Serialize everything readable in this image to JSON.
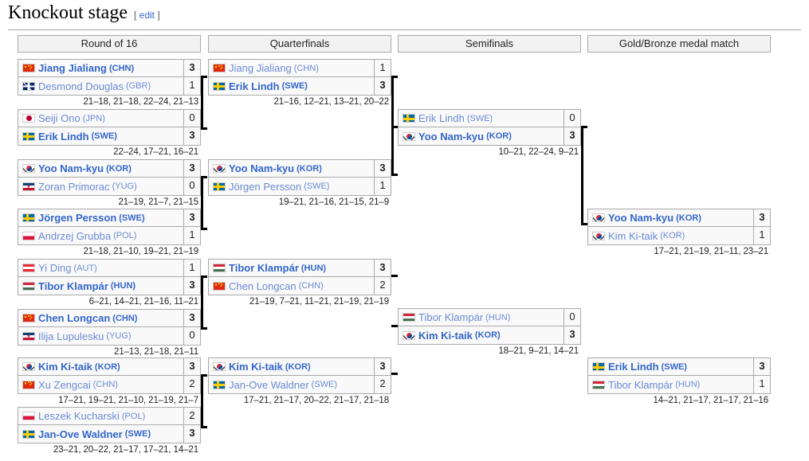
{
  "heading": {
    "title": "Knockout stage",
    "edit_open": "[",
    "edit_label": "edit",
    "edit_close": "]"
  },
  "columns": [
    {
      "label": "Round of 16"
    },
    {
      "label": "Quarterfinals"
    },
    {
      "label": "Semifinals"
    },
    {
      "label": "Gold/Bronze medal match"
    }
  ],
  "matches": {
    "r16_1": {
      "p1": {
        "name": "Jiang Jialiang",
        "code": "(CHN)",
        "flag": "f-chn",
        "score": "3",
        "winner": true
      },
      "p2": {
        "name": "Desmond Douglas",
        "code": "(GBR)",
        "flag": "f-gbr",
        "score": "1",
        "winner": false
      },
      "scores": "21–18, 21–18, 22–24, 21–13"
    },
    "r16_2": {
      "p1": {
        "name": "Seiji Ono",
        "code": "(JPN)",
        "flag": "f-jpn",
        "score": "0",
        "winner": false
      },
      "p2": {
        "name": "Erik Lindh",
        "code": "(SWE)",
        "flag": "f-swe",
        "score": "3",
        "winner": true
      },
      "scores": "22–24, 17–21, 16–21"
    },
    "r16_3": {
      "p1": {
        "name": "Yoo Nam-kyu",
        "code": "(KOR)",
        "flag": "f-kor",
        "score": "3",
        "winner": true
      },
      "p2": {
        "name": "Zoran Primorac",
        "code": "(YUG)",
        "flag": "f-yug",
        "score": "0",
        "winner": false
      },
      "scores": "21–19, 21–7, 21–15"
    },
    "r16_4": {
      "p1": {
        "name": "Jörgen Persson",
        "code": "(SWE)",
        "flag": "f-swe",
        "score": "3",
        "winner": true
      },
      "p2": {
        "name": "Andrzej Grubba",
        "code": "(POL)",
        "flag": "f-pol",
        "score": "1",
        "winner": false
      },
      "scores": "21–18, 21–10, 19–21, 21–19"
    },
    "r16_5": {
      "p1": {
        "name": "Yi Ding",
        "code": "(AUT)",
        "flag": "f-aut",
        "score": "1",
        "winner": false
      },
      "p2": {
        "name": "Tibor Klampár",
        "code": "(HUN)",
        "flag": "f-hun",
        "score": "3",
        "winner": true
      },
      "scores": "6–21, 14–21, 21–16, 11–21"
    },
    "r16_6": {
      "p1": {
        "name": "Chen Longcan",
        "code": "(CHN)",
        "flag": "f-chn",
        "score": "3",
        "winner": true
      },
      "p2": {
        "name": "Ilija Lupulesku",
        "code": "(YUG)",
        "flag": "f-yug",
        "score": "0",
        "winner": false
      },
      "scores": "21–13, 21–18, 21–11"
    },
    "r16_7": {
      "p1": {
        "name": "Kim Ki-taik",
        "code": "(KOR)",
        "flag": "f-kor",
        "score": "3",
        "winner": true
      },
      "p2": {
        "name": "Xu Zengcai",
        "code": "(CHN)",
        "flag": "f-chn",
        "score": "2",
        "winner": false
      },
      "scores": "17–21, 19–21, 21–10, 21–19, 21–7"
    },
    "r16_8": {
      "p1": {
        "name": "Leszek Kucharski",
        "code": "(POL)",
        "flag": "f-pol",
        "score": "2",
        "winner": false
      },
      "p2": {
        "name": "Jan-Ove Waldner",
        "code": "(SWE)",
        "flag": "f-swe",
        "score": "3",
        "winner": true
      },
      "scores": "23–21, 20–22, 21–17, 17–21, 14–21"
    },
    "qf_1": {
      "p1": {
        "name": "Jiang Jialiang",
        "code": "(CHN)",
        "flag": "f-chn",
        "score": "1",
        "winner": false
      },
      "p2": {
        "name": "Erik Lindh",
        "code": "(SWE)",
        "flag": "f-swe",
        "score": "3",
        "winner": true
      },
      "scores": "21–16, 12–21, 13–21, 20–22"
    },
    "qf_2": {
      "p1": {
        "name": "Yoo Nam-kyu",
        "code": "(KOR)",
        "flag": "f-kor",
        "score": "3",
        "winner": true
      },
      "p2": {
        "name": "Jörgen Persson",
        "code": "(SWE)",
        "flag": "f-swe",
        "score": "1",
        "winner": false
      },
      "scores": "19–21, 21–16, 21–15, 21–9"
    },
    "qf_3": {
      "p1": {
        "name": "Tibor Klampár",
        "code": "(HUN)",
        "flag": "f-hun",
        "score": "3",
        "winner": true
      },
      "p2": {
        "name": "Chen Longcan",
        "code": "(CHN)",
        "flag": "f-chn",
        "score": "2",
        "winner": false
      },
      "scores": "21–19, 7–21, 11–21, 21–19, 21–19"
    },
    "qf_4": {
      "p1": {
        "name": "Kim Ki-taik",
        "code": "(KOR)",
        "flag": "f-kor",
        "score": "3",
        "winner": true
      },
      "p2": {
        "name": "Jan-Ove Waldner",
        "code": "(SWE)",
        "flag": "f-swe",
        "score": "2",
        "winner": false
      },
      "scores": "17–21, 21–17, 20–22, 21–17, 21–18"
    },
    "sf_1": {
      "p1": {
        "name": "Erik Lindh",
        "code": "(SWE)",
        "flag": "f-swe",
        "score": "0",
        "winner": false
      },
      "p2": {
        "name": "Yoo Nam-kyu",
        "code": "(KOR)",
        "flag": "f-kor",
        "score": "3",
        "winner": true
      },
      "scores": "10–21, 22–24, 9–21"
    },
    "sf_2": {
      "p1": {
        "name": "Tibor Klampár",
        "code": "(HUN)",
        "flag": "f-hun",
        "score": "0",
        "winner": false
      },
      "p2": {
        "name": "Kim Ki-taik",
        "code": "(KOR)",
        "flag": "f-kor",
        "score": "3",
        "winner": true
      },
      "scores": "18–21, 9–21, 14–21"
    },
    "gold": {
      "p1": {
        "name": "Yoo Nam-kyu",
        "code": "(KOR)",
        "flag": "f-kor",
        "score": "3",
        "winner": true
      },
      "p2": {
        "name": "Kim Ki-taik",
        "code": "(KOR)",
        "flag": "f-kor",
        "score": "1",
        "winner": false
      },
      "scores": "17–21, 21–19, 21–11, 23–21"
    },
    "bronze": {
      "p1": {
        "name": "Erik Lindh",
        "code": "(SWE)",
        "flag": "f-swe",
        "score": "3",
        "winner": true
      },
      "p2": {
        "name": "Tibor Klampár",
        "code": "(HUN)",
        "flag": "f-hun",
        "score": "1",
        "winner": false
      },
      "scores": "14–21, 21–17, 21–17, 21–16"
    }
  }
}
